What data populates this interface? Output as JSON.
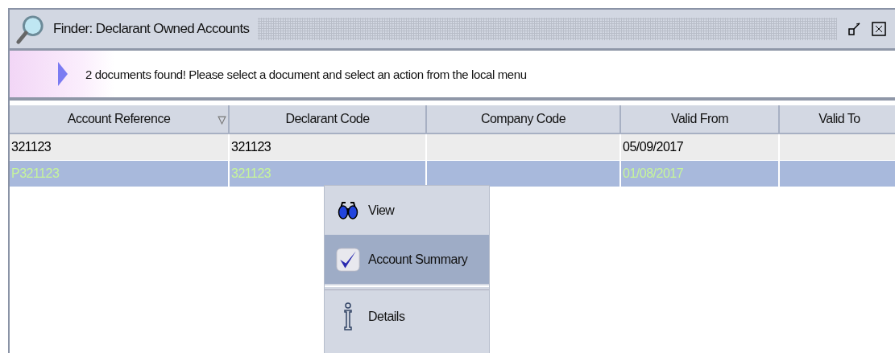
{
  "window": {
    "title": "Finder: Declarant Owned Accounts"
  },
  "message": "2 documents found! Please select a document and select an action from the local menu",
  "table": {
    "columns": [
      {
        "label": "Account Reference",
        "sorted": true
      },
      {
        "label": "Declarant Code",
        "sorted": false
      },
      {
        "label": "Company Code",
        "sorted": false
      },
      {
        "label": "Valid From",
        "sorted": false
      },
      {
        "label": "Valid To",
        "sorted": false
      }
    ],
    "rows": [
      {
        "selected": false,
        "cells": [
          "321123",
          "321123",
          "",
          "05/09/2017",
          ""
        ]
      },
      {
        "selected": true,
        "cells": [
          "P321123",
          "321123",
          "",
          "01/08/2017",
          ""
        ]
      }
    ]
  },
  "context_menu": {
    "items": [
      {
        "kind": "view",
        "label": "View",
        "selected": false
      },
      {
        "kind": "summary",
        "label": "Account Summary",
        "selected": true
      },
      {
        "kind": "details",
        "label": "Details",
        "selected": false
      }
    ]
  }
}
